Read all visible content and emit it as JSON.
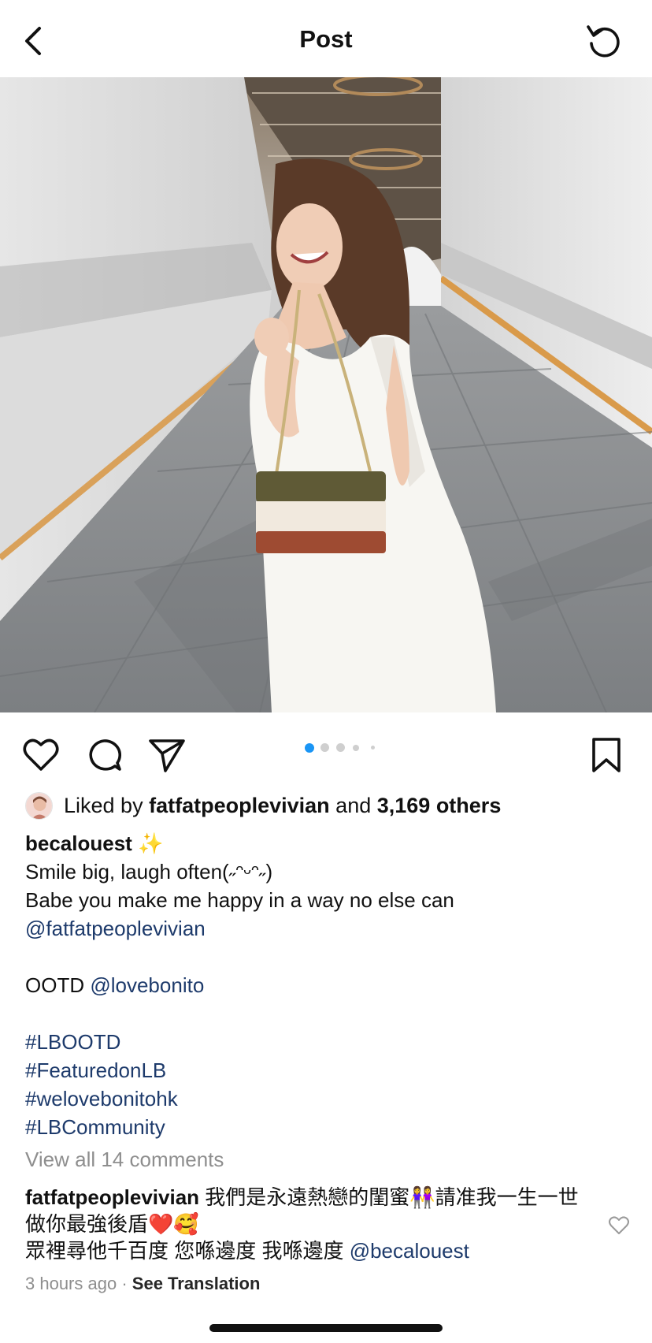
{
  "header": {
    "title": "Post",
    "back_icon": "chevron-left-icon",
    "refresh_icon": "refresh-icon"
  },
  "post": {
    "image_alt": "Woman in a white dress with an olive, cream and brown shoulder bag smiling in a corridor",
    "carousel": {
      "count": 5,
      "active_index": 0
    },
    "actions": {
      "like_icon": "heart-icon",
      "comment_icon": "comment-bubble-icon",
      "share_icon": "paper-plane-icon",
      "save_icon": "bookmark-icon"
    },
    "likes": {
      "prefix": "Liked by",
      "user": "fatfatpeoplevivian",
      "middle": "and",
      "others": "3,169 others"
    },
    "caption": {
      "username": "becalouest",
      "sparkle": "✨",
      "line1": "Smile big, laugh often(˶ᵔᵕᵔ˶)",
      "line2": "Babe you make me happy in a way no else can",
      "mention1": "@fatfatpeoplevivian",
      "ootd_text": "OOTD",
      "ootd_mention": "@lovebonito",
      "hashtags": [
        "#LBOOTD",
        "#FeaturedonLB",
        "#welovebonitohk",
        "#LBCommunity"
      ]
    },
    "view_all_comments": "View all 14 comments",
    "top_comment": {
      "username": "fatfatpeoplevivian",
      "text1": "我們是永遠熱戀的閨蜜👭請准我一生一世做你最強後盾❤️🥰",
      "text2": "眾裡尋他千百度 您喺邊度 我喺邊度",
      "mention": "@becalouest"
    },
    "time_ago": "3 hours ago",
    "separator": "·",
    "see_translation": "See Translation"
  },
  "colors": {
    "link": "#1d3a6b",
    "muted": "#8e8e8e",
    "active_dot": "#1a95f5",
    "inactive_dot": "#cfcfcf"
  }
}
